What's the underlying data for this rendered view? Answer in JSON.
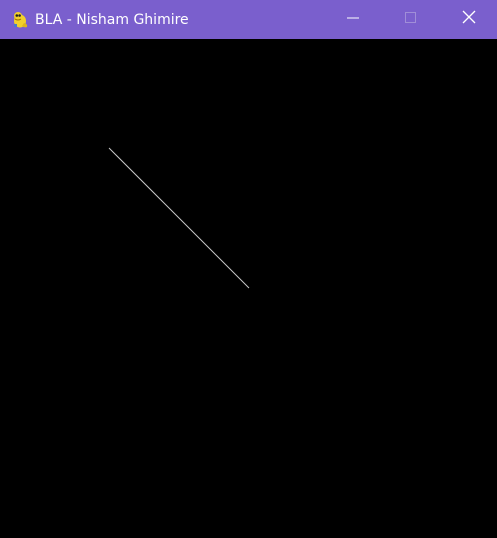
{
  "window": {
    "title": "BLA - Nisham Ghimire",
    "app_icon": "pygame-snake-icon",
    "titlebar_color": "#7a5fcd",
    "controls": {
      "minimize_icon": "minimize-icon",
      "maximize_icon": "maximize-icon",
      "maximize_enabled": false,
      "close_icon": "close-icon"
    }
  },
  "canvas": {
    "background": "#000000",
    "line_color": "#c8c8c8"
  }
}
